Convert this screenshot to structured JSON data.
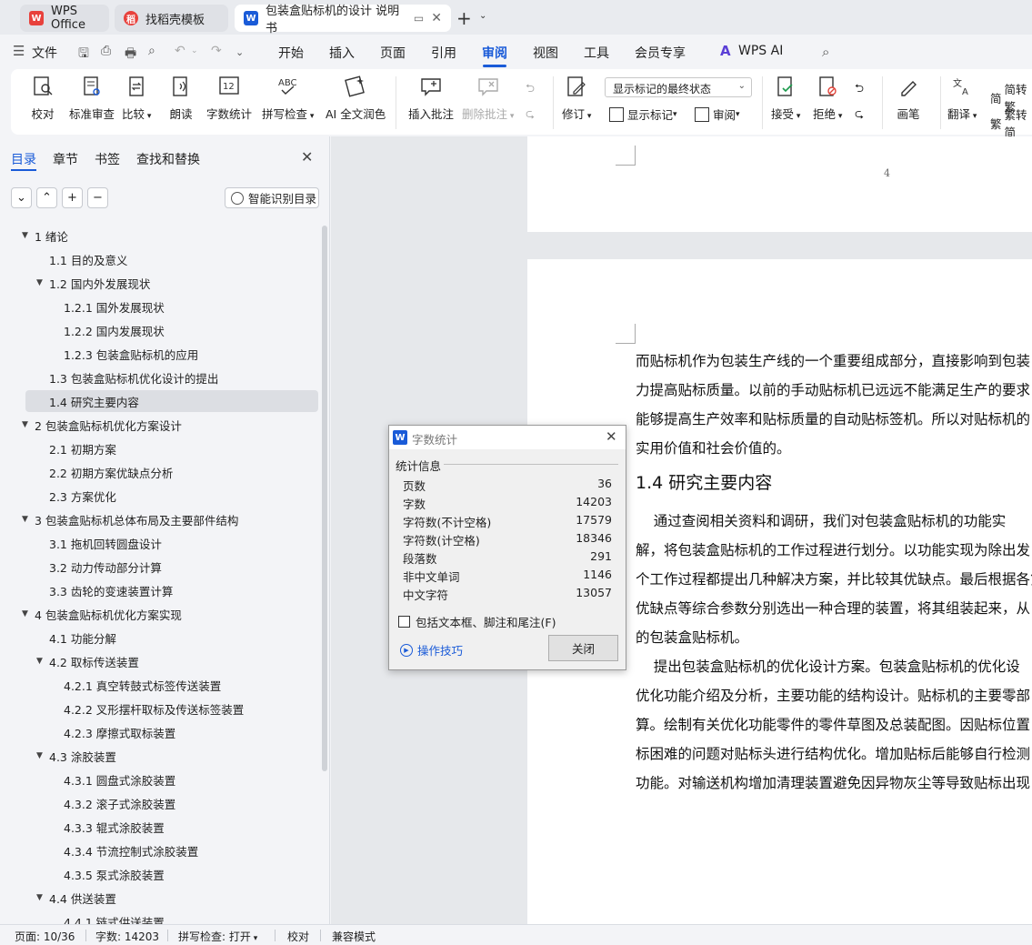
{
  "tabs": [
    {
      "label": "WPS Office",
      "icon": "wps-logo-icon",
      "color": "#e8413c"
    },
    {
      "label": "找稻壳模板",
      "icon": "docer-icon",
      "color": "#e8413c"
    },
    {
      "label": "包装盒贴标机的设计 说明书",
      "icon": "writer-icon",
      "color": "#1a5bd8"
    }
  ],
  "menu": {
    "file": "文件",
    "items": [
      "开始",
      "插入",
      "页面",
      "引用",
      "审阅",
      "视图",
      "工具",
      "会员专享"
    ],
    "active": "审阅",
    "wps_ai": "WPS AI"
  },
  "ribbon": {
    "proofread": "校对",
    "standard_review": "标准审查",
    "compare": "比较",
    "read_aloud": "朗读",
    "word_count": "字数统计",
    "spell_check": "拼写检查",
    "ai_polish": "AI 全文润色",
    "insert_comment": "插入批注",
    "delete_comment": "删除批注",
    "track_changes": "修订",
    "markup_select": "显示标记的最终状态",
    "show_markup": "显示标记",
    "review": "审阅",
    "accept": "接受",
    "reject": "拒绝",
    "pen": "画笔",
    "translate": "翻译",
    "to_traditional": "简转繁",
    "to_simplified": "繁转简"
  },
  "nav_pane": {
    "tabs": [
      "目录",
      "章节",
      "书签",
      "查找和替换"
    ],
    "smart_toc": "智能识别目录",
    "toc": [
      {
        "label": "1 绪论",
        "level": 1,
        "expanded": true
      },
      {
        "label": "1.1 目的及意义",
        "level": 2
      },
      {
        "label": "1.2 国内外发展现状",
        "level": 2,
        "expanded": true
      },
      {
        "label": "1.2.1 国外发展现状",
        "level": 3
      },
      {
        "label": "1.2.2 国内发展现状",
        "level": 3
      },
      {
        "label": "1.2.3 包装盒贴标机的应用",
        "level": 3
      },
      {
        "label": "1.3 包装盒贴标机优化设计的提出",
        "level": 2
      },
      {
        "label": "1.4 研究主要内容",
        "level": 2,
        "selected": true
      },
      {
        "label": "2 包装盒贴标机优化方案设计",
        "level": 1,
        "expanded": true
      },
      {
        "label": "2.1 初期方案",
        "level": 2
      },
      {
        "label": "2.2 初期方案优缺点分析",
        "level": 2
      },
      {
        "label": "2.3 方案优化",
        "level": 2
      },
      {
        "label": "3 包装盒贴标机总体布局及主要部件结构",
        "level": 1,
        "expanded": true
      },
      {
        "label": "3.1 拖机回转圆盘设计",
        "level": 2
      },
      {
        "label": "3.2 动力传动部分计算",
        "level": 2
      },
      {
        "label": "3.3 齿轮的变速装置计算",
        "level": 2
      },
      {
        "label": "4 包装盒贴标机优化方案实现",
        "level": 1,
        "expanded": true
      },
      {
        "label": "4.1 功能分解",
        "level": 2
      },
      {
        "label": "4.2 取标传送装置",
        "level": 2,
        "expanded": true
      },
      {
        "label": "4.2.1 真空转鼓式标签传送装置",
        "level": 3
      },
      {
        "label": "4.2.2 叉形摆杆取标及传送标签装置",
        "level": 3
      },
      {
        "label": "4.2.3 摩擦式取标装置",
        "level": 3
      },
      {
        "label": "4.3 涂胶装置",
        "level": 2,
        "expanded": true
      },
      {
        "label": "4.3.1 圆盘式涂胶装置",
        "level": 3
      },
      {
        "label": "4.3.2 滚子式涂胶装置",
        "level": 3
      },
      {
        "label": "4.3.3 辊式涂胶装置",
        "level": 3
      },
      {
        "label": "4.3.4 节流控制式涂胶装置",
        "level": 3
      },
      {
        "label": "4.3.5 泵式涂胶装置",
        "level": 3
      },
      {
        "label": "4.4 供送装置",
        "level": 2,
        "expanded": true
      },
      {
        "label": "4.4.1 链式供送装置",
        "level": 3
      }
    ]
  },
  "document": {
    "page_number": "4",
    "lines_before": [
      "而贴标机作为包装生产线的一个重要组成部分，直接影响到包装",
      "力提高贴标质量。以前的手动贴标机已远远不能满足生产的要求",
      "能够提高生产效率和贴标质量的自动贴标签机。所以对贴标机的",
      "实用价值和社会价值的。"
    ],
    "heading": "1.4 研究主要内容",
    "lines_after": [
      "    通过查阅相关资料和调研，我们对包装盒贴标机的功能实",
      "解，将包装盒贴标机的工作过程进行划分。以功能实现为除出发",
      "个工作过程都提出几种解决方案，并比较其优缺点。最后根据各第",
      "优缺点等综合参数分别选出一种合理的装置，将其组装起来，从",
      "的包装盒贴标机。",
      "    提出包装盒贴标机的优化设计方案。包装盒贴标机的优化设",
      "优化功能介绍及分析，主要功能的结构设计。贴标机的主要零部",
      "算。绘制有关优化功能零件的零件草图及总装配图。因贴标位置",
      "标困难的问题对贴标头进行结构优化。增加贴标后能够自行检测",
      "功能。对输送机构增加清理装置避免因异物灰尘等导致贴标出现"
    ]
  },
  "dialog": {
    "title": "字数统计",
    "group": "统计信息",
    "stats": [
      {
        "label": "页数",
        "value": "36"
      },
      {
        "label": "字数",
        "value": "14203"
      },
      {
        "label": "字符数(不计空格)",
        "value": "17579"
      },
      {
        "label": "字符数(计空格)",
        "value": "18346"
      },
      {
        "label": "段落数",
        "value": "291"
      },
      {
        "label": "非中文单词",
        "value": "1146"
      },
      {
        "label": "中文字符",
        "value": "13057"
      }
    ],
    "include_label": "包括文本框、脚注和尾注(F)",
    "include_checked": false,
    "tips": "操作技巧",
    "close": "关闭"
  },
  "status": {
    "page": "页面: 10/36",
    "words": "字数: 14203",
    "spell": "拼写检查: 打开",
    "proof": "校对",
    "compat": "兼容模式"
  }
}
